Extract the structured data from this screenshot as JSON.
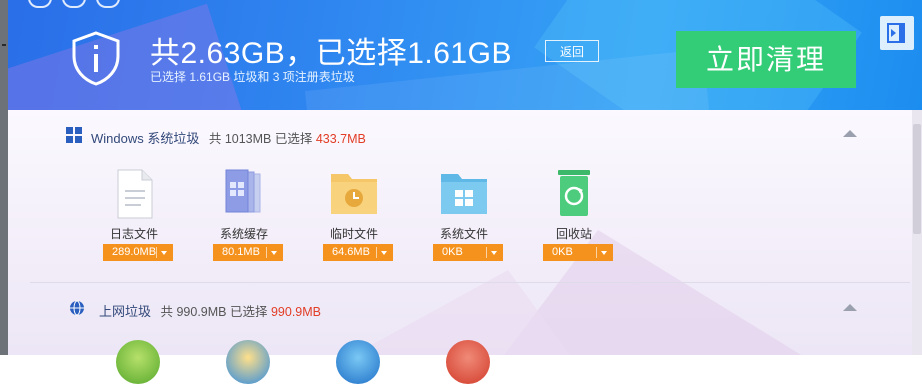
{
  "header": {
    "title": "共2.63GB，已选择1.61GB",
    "subtitle": "已选择 1.61GB 垃圾和 3 项注册表垃圾",
    "back_label": "返回",
    "clean_label": "立即清理",
    "exit_icon": "exit-panel-icon"
  },
  "sections": [
    {
      "name": "Windows 系统垃圾",
      "total_prefix": "共 1013MB 已选择",
      "selected": "433.7MB",
      "icon": "windows-logo-icon",
      "items": [
        {
          "label": "日志文件",
          "size": "289.0MB",
          "icon": "log-file-icon"
        },
        {
          "label": "系统缓存",
          "size": "80.1MB",
          "icon": "system-cache-icon"
        },
        {
          "label": "临时文件",
          "size": "64.6MB",
          "icon": "temp-folder-icon"
        },
        {
          "label": "系统文件",
          "size": "0KB",
          "icon": "system-folder-icon"
        },
        {
          "label": "回收站",
          "size": "0KB",
          "icon": "recycle-bin-icon"
        }
      ]
    },
    {
      "name": "上网垃圾",
      "total_prefix": "共 990.9MB 已选择",
      "selected": "990.9MB",
      "icon": "globe-icon"
    }
  ],
  "colors": {
    "header_blue": "#2f86f0",
    "clean_green": "#33cc77",
    "selected_red": "#e23d25",
    "dropdown_orange": "#f5921e"
  }
}
